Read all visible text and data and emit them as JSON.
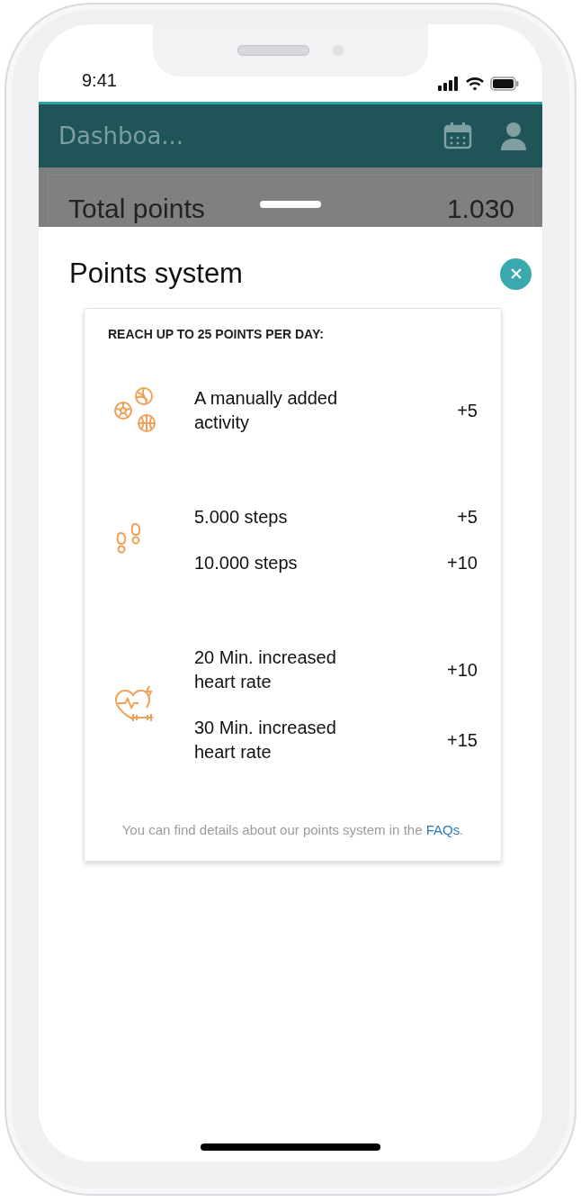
{
  "status_bar": {
    "time": "9:41"
  },
  "app_bar": {
    "title": "Dashboa..."
  },
  "background_card": {
    "label": "Total points",
    "value": "1.030"
  },
  "sheet": {
    "title": "Points system",
    "card": {
      "heading": "REACH UP TO 25 POINTS PER DAY:",
      "groups": [
        {
          "kind": "activity",
          "items": [
            {
              "label": "A manually added activity",
              "points": "+5"
            }
          ]
        },
        {
          "kind": "steps",
          "items": [
            {
              "label": "5.000 steps",
              "points": "+5"
            },
            {
              "label": "10.000 steps",
              "points": "+10"
            }
          ]
        },
        {
          "kind": "heart",
          "items": [
            {
              "label": "20 Min. increased heart rate",
              "points": "+10"
            },
            {
              "label": "30 Min. increased heart rate",
              "points": "+15"
            }
          ]
        }
      ],
      "footer": {
        "text": "You can find details about our points system in the",
        "link": "FAQs",
        "end": "."
      }
    }
  }
}
